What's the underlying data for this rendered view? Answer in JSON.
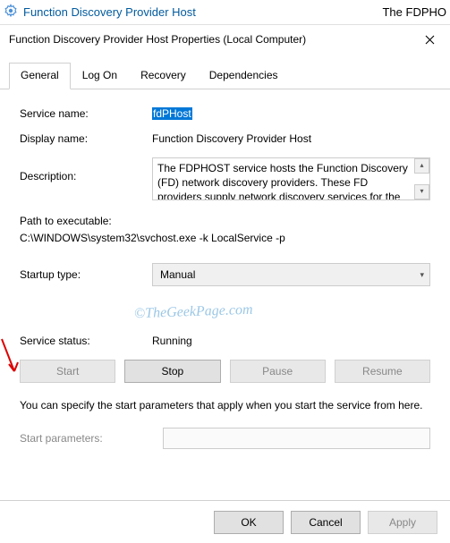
{
  "topbar": {
    "title": "Function Discovery Provider Host",
    "right_text": "The FDPHO"
  },
  "dialog": {
    "title": "Function Discovery Provider Host Properties (Local Computer)"
  },
  "tabs": {
    "items": [
      {
        "label": "General"
      },
      {
        "label": "Log On"
      },
      {
        "label": "Recovery"
      },
      {
        "label": "Dependencies"
      }
    ]
  },
  "fields": {
    "service_name_label": "Service name:",
    "service_name_value": "fdPHost",
    "display_name_label": "Display name:",
    "display_name_value": "Function Discovery Provider Host",
    "description_label": "Description:",
    "description_value": "The FDPHOST service hosts the Function Discovery (FD) network discovery providers. These FD providers supply network discovery services for the Simple",
    "path_label": "Path to executable:",
    "path_value": "C:\\WINDOWS\\system32\\svchost.exe -k LocalService -p",
    "startup_label": "Startup type:",
    "startup_value": "Manual",
    "status_label": "Service status:",
    "status_value": "Running",
    "hint": "You can specify the start parameters that apply when you start the service from here.",
    "start_params_label": "Start parameters:",
    "start_params_value": ""
  },
  "buttons": {
    "start": "Start",
    "stop": "Stop",
    "pause": "Pause",
    "resume": "Resume",
    "ok": "OK",
    "cancel": "Cancel",
    "apply": "Apply"
  },
  "watermark": "©TheGeekPage.com"
}
